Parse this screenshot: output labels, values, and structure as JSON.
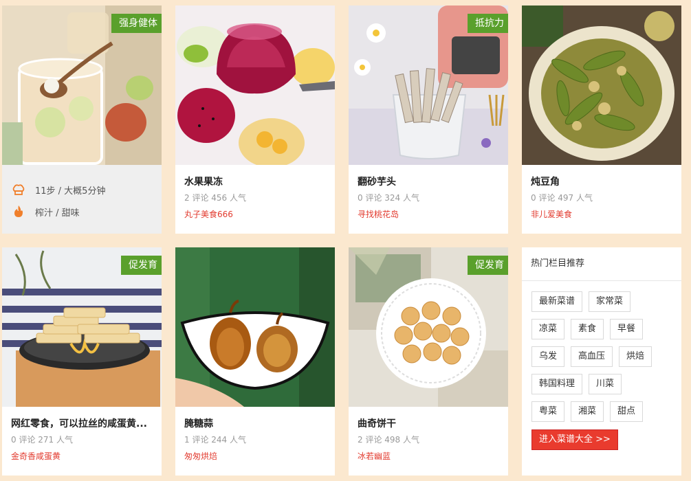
{
  "cards": [
    {
      "tag": "强身健体",
      "hover": {
        "steps": "11步 / 大概5分钟",
        "taste": "榨汁 / 甜味"
      }
    },
    {
      "title": "水果果冻",
      "stats": "2 评论 456 人气",
      "author": "丸子美食666"
    },
    {
      "tag": "抵抗力",
      "title": "翻砂芋头",
      "stats": "0 评论 324 人气",
      "author": "寻找桃花岛"
    },
    {
      "title": "炖豆角",
      "stats": "0 评论 497 人气",
      "author": "非儿爱美食"
    },
    {
      "tag": "促发育",
      "title": "网红零食，可以拉丝的咸蛋黄...",
      "stats": "0 评论 271 人气",
      "author": "金奇香咸蛋黄"
    },
    {
      "title": "腌糖蒜",
      "stats": "1 评论 244 人气",
      "author": "匆匆烘焙"
    },
    {
      "tag": "促发育",
      "title": "曲奇饼干",
      "stats": "2 评论 498 人气",
      "author": "冰若幽蓝"
    }
  ],
  "sidebar": {
    "heading": "热门栏目推荐",
    "rows": [
      [
        "最新菜谱",
        "家常菜"
      ],
      [
        "凉菜",
        "素食",
        "早餐"
      ],
      [
        "乌发",
        "高血压",
        "烘焙"
      ],
      [
        "韩国料理",
        "川菜"
      ],
      [
        "粤菜",
        "湘菜",
        "甜点"
      ]
    ],
    "all_button": "进入菜谱大全 >>"
  },
  "colors": {
    "accent": "#e93b2e",
    "tag": "#5aa02c",
    "background": "#fbe8cf"
  }
}
